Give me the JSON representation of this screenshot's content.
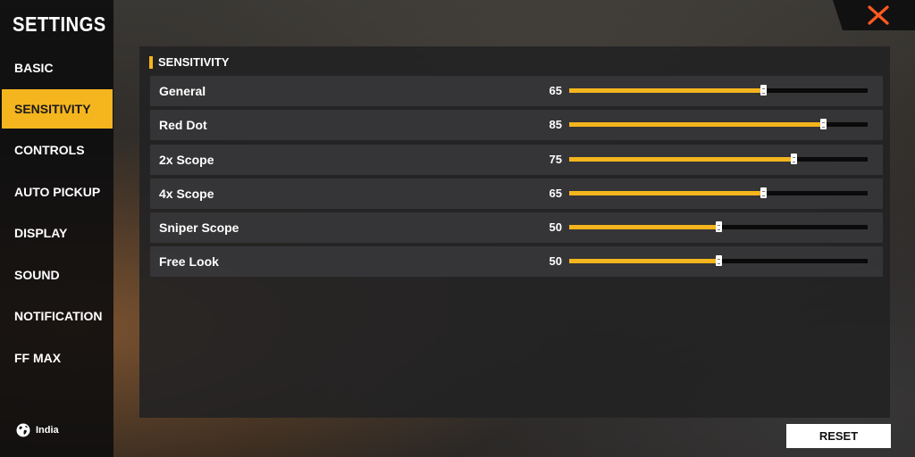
{
  "sidebar": {
    "title": "SETTINGS",
    "items": [
      {
        "label": "BASIC",
        "active": false
      },
      {
        "label": "SENSITIVITY",
        "active": true
      },
      {
        "label": "CONTROLS",
        "active": false
      },
      {
        "label": "AUTO PICKUP",
        "active": false
      },
      {
        "label": "DISPLAY",
        "active": false
      },
      {
        "label": "SOUND",
        "active": false
      },
      {
        "label": "NOTIFICATION",
        "active": false
      },
      {
        "label": "FF MAX",
        "active": false
      }
    ],
    "region": {
      "icon": "globe-icon",
      "label": "India"
    }
  },
  "header": {
    "close_icon": "close-icon"
  },
  "section": {
    "title": "SENSITIVITY",
    "sliders": [
      {
        "label": "General",
        "value": 65
      },
      {
        "label": "Red Dot",
        "value": 85
      },
      {
        "label": "2x Scope",
        "value": 75
      },
      {
        "label": "4x Scope",
        "value": 65
      },
      {
        "label": "Sniper Scope",
        "value": 50
      },
      {
        "label": "Free Look",
        "value": 50
      }
    ],
    "slider_max": 100
  },
  "footer": {
    "reset_label": "RESET"
  },
  "colors": {
    "accent": "#f5b51e",
    "close": "#ff5a1f",
    "track": "#0a0a0a"
  }
}
